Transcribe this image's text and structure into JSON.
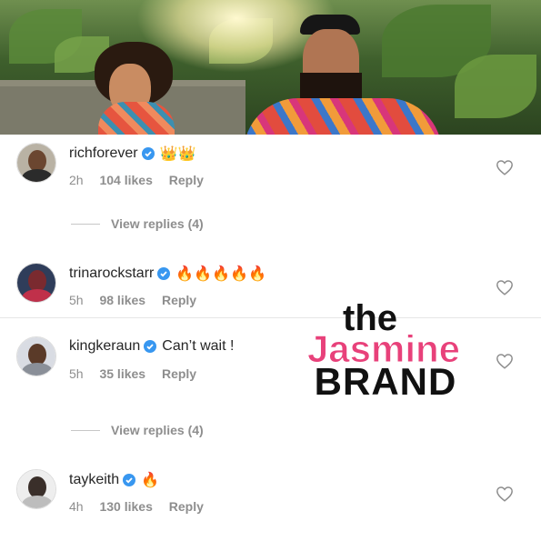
{
  "hero": {
    "alt": "photo"
  },
  "comments": [
    {
      "username": "richforever",
      "text": "👑👑",
      "time": "2h",
      "likes": "104 likes",
      "reply": "Reply"
    },
    {
      "username": "trinarockstarr",
      "text": "🔥🔥🔥🔥🔥",
      "time": "5h",
      "likes": "98 likes",
      "reply": "Reply"
    },
    {
      "username": "kingkeraun",
      "text": "Can’t wait !",
      "time": "5h",
      "likes": "35 likes",
      "reply": "Reply"
    },
    {
      "username": "taykeith",
      "text": "🔥",
      "time": "4h",
      "likes": "130 likes",
      "reply": "Reply"
    }
  ],
  "view_replies": [
    "View replies (4)",
    "View replies (4)"
  ],
  "watermark": {
    "line1": "the",
    "line2": "Jasmine",
    "line3": "BRAND"
  },
  "colors": {
    "verified": "#3897f0",
    "text": "#262626",
    "meta": "#8e8e8e",
    "brand_pink": "#e8417a"
  }
}
